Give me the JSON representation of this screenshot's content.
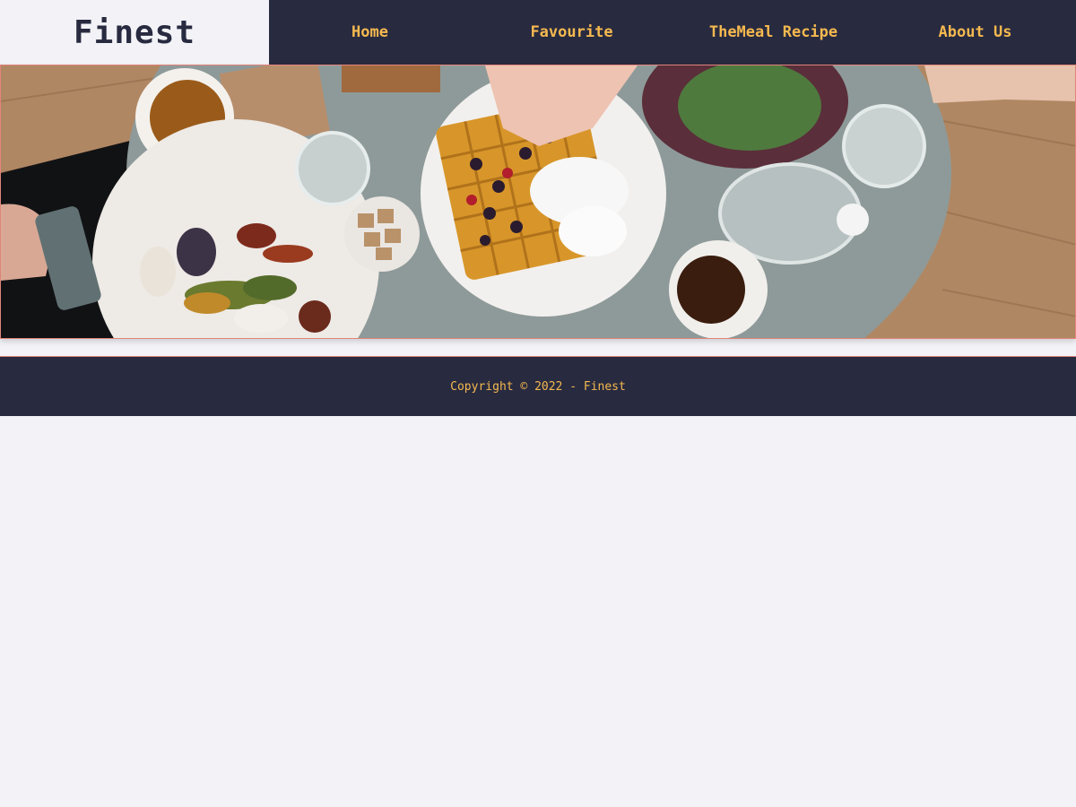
{
  "brand": {
    "name": "Finest"
  },
  "nav": {
    "items": [
      {
        "label": "Home"
      },
      {
        "label": "Favourite"
      },
      {
        "label": "TheMeal Recipe"
      },
      {
        "label": "About Us"
      }
    ]
  },
  "hero": {
    "image": "brunch-table-photo"
  },
  "footer": {
    "copyright": "Copyright © 2022 - Finest"
  },
  "colors": {
    "nav_bg": "#282a40",
    "accent": "#f5b94f",
    "page_bg": "#f2f2f7",
    "border": "#e0857a"
  }
}
